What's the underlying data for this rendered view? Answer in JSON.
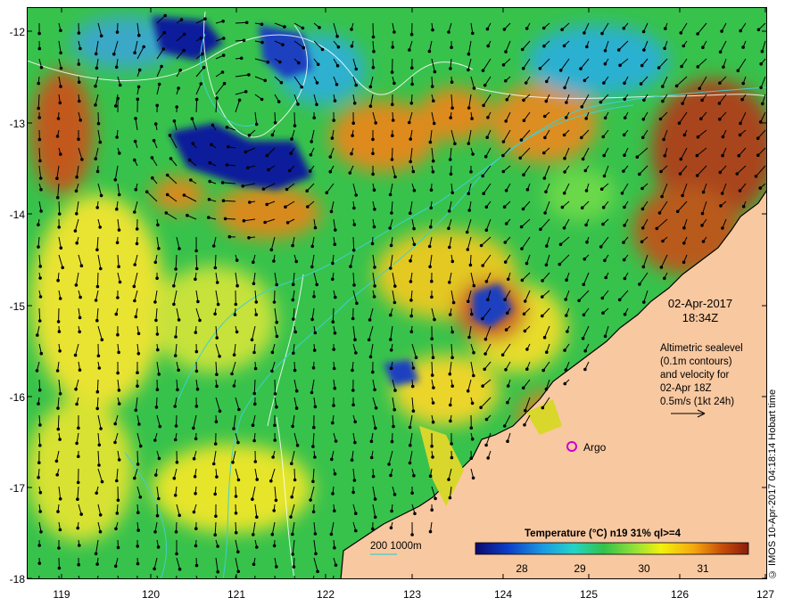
{
  "map": {
    "date": "02-Apr-2017",
    "time": "18:34Z",
    "legend_lines": [
      "Altimetric sealevel",
      "(0.1m contours)",
      "and velocity for",
      "02-Apr 18Z",
      "0.5m/s (1kt 24h)"
    ],
    "argo_label": "Argo",
    "bathy_label": "200  1000m",
    "colorbar": {
      "title": "Temperature (°C) n19 31% ql>=4",
      "ticks": [
        "28",
        "29",
        "30",
        "31"
      ],
      "colors": [
        "#0a0a6e",
        "#0d3fc8",
        "#1c9be3",
        "#24d3c8",
        "#33c24a",
        "#8fe03a",
        "#f2f20c",
        "#f5a70e",
        "#c8500a",
        "#8a1c0c"
      ]
    },
    "y_ticks": [
      "-12",
      "-13",
      "-14",
      "-15",
      "-16",
      "-17",
      "-18"
    ],
    "x_ticks": [
      "119",
      "120",
      "121",
      "122",
      "123",
      "124",
      "125",
      "126",
      "127"
    ],
    "credit": "© IMOS 10-Apr-2017 04:18:14 Hobart time",
    "colors": {
      "land": "#f8c8a0",
      "ocean_base": "#37c24c",
      "warm": "#e58a16",
      "hot": "#a8441a",
      "cold": "#0d1f9a",
      "cyan": "#3fd0d0",
      "argo": "#cc00cc"
    }
  }
}
